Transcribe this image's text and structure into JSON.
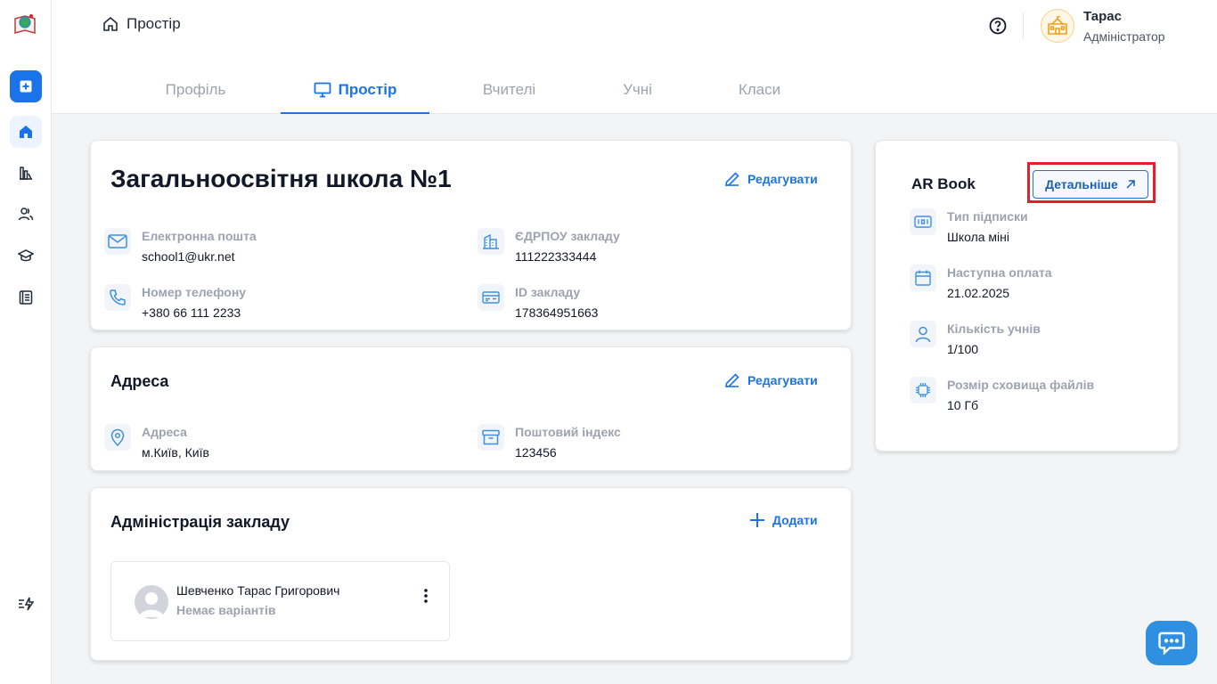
{
  "header": {
    "breadcrumb": "Простір",
    "user": {
      "name": "Тарас",
      "role": "Адміністратор"
    }
  },
  "tabs": [
    {
      "label": "Профіль",
      "active": false
    },
    {
      "label": "Простір",
      "active": true
    },
    {
      "label": "Вчителі",
      "active": false
    },
    {
      "label": "Учні",
      "active": false
    },
    {
      "label": "Класи",
      "active": false
    }
  ],
  "school": {
    "title": "Загальноосвітня школа №1",
    "edit_label": "Редагувати",
    "fields": [
      {
        "label": "Електронна пошта",
        "value": "school1@ukr.net",
        "icon": "mail-icon"
      },
      {
        "label": "ЄДРПОУ закладу",
        "value": "111222333444",
        "icon": "building-icon"
      },
      {
        "label": "Номер телефону",
        "value": "+380 66 111 2233",
        "icon": "phone-icon"
      },
      {
        "label": "ID закладу",
        "value": "178364951663",
        "icon": "id-card-icon"
      }
    ]
  },
  "address": {
    "title": "Адреса",
    "edit_label": "Редагувати",
    "fields": [
      {
        "label": "Адреса",
        "value": "м.Київ, Київ",
        "icon": "location-pin-icon"
      },
      {
        "label": "Поштовий індекс",
        "value": "123456",
        "icon": "archive-box-icon"
      }
    ]
  },
  "administration": {
    "title": "Адміністрація закладу",
    "add_label": "Додати",
    "members": [
      {
        "name": "Шевченко Тарас Григорович",
        "subtitle": "Немає варіантів"
      }
    ]
  },
  "subscription": {
    "title": "AR Book",
    "details_label": "Детальніше",
    "fields": [
      {
        "label": "Тип підписки",
        "value": "Школа міні",
        "icon": "ticket-icon"
      },
      {
        "label": "Наступна оплата",
        "value": "21.02.2025",
        "icon": "calendar-icon"
      },
      {
        "label": "Кількість учнів",
        "value": "1/100",
        "icon": "user-icon"
      },
      {
        "label": "Розмір сховища файлів",
        "value": "10 Гб",
        "icon": "chip-icon"
      }
    ]
  },
  "colors": {
    "accent": "#1a73e8",
    "highlight": "#e0202a"
  }
}
